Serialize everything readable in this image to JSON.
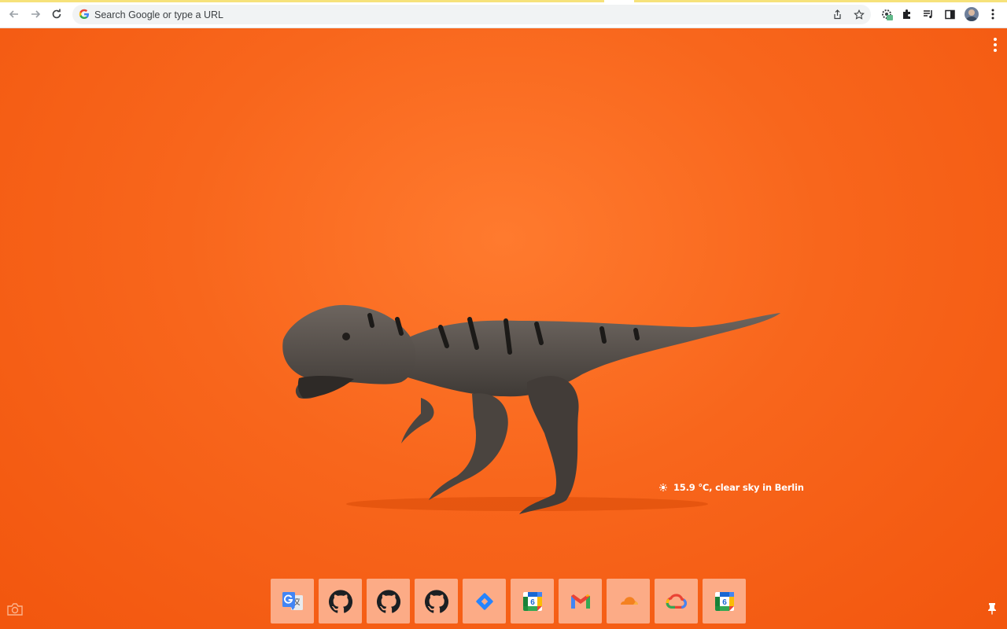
{
  "browser": {
    "omnibox": {
      "placeholder": "Search Google or type a URL",
      "value": ""
    },
    "toolbar_icons": [
      "back-icon",
      "forward-icon",
      "reload-icon",
      "share-icon",
      "bookmark-star-icon",
      "extension-icon",
      "puzzle-icon",
      "media-icon",
      "sidepanel-icon",
      "avatar",
      "menu-icon"
    ]
  },
  "page": {
    "wallpaper": {
      "subject": "toy-dinosaur",
      "background_color": "#f8661c"
    },
    "weather": {
      "text": "15.9 °C, clear sky in Berlin",
      "icon": "sun-icon"
    },
    "shortcuts": [
      {
        "name": "google-translate",
        "icon": "google-translate-icon"
      },
      {
        "name": "github-1",
        "icon": "github-icon"
      },
      {
        "name": "github-2",
        "icon": "github-icon"
      },
      {
        "name": "github-3",
        "icon": "github-icon"
      },
      {
        "name": "jira",
        "icon": "jira-icon"
      },
      {
        "name": "google-calendar-1",
        "icon": "google-calendar-icon",
        "label": "6"
      },
      {
        "name": "gmail",
        "icon": "gmail-icon"
      },
      {
        "name": "cloudflare",
        "icon": "cloudflare-icon"
      },
      {
        "name": "google-cloud",
        "icon": "google-cloud-icon"
      },
      {
        "name": "google-calendar-2",
        "icon": "google-calendar-icon",
        "label": "6"
      }
    ]
  },
  "colors": {
    "accent": "#f8661c",
    "tile": "#fcab86",
    "loadbar": "#f6e27a"
  }
}
